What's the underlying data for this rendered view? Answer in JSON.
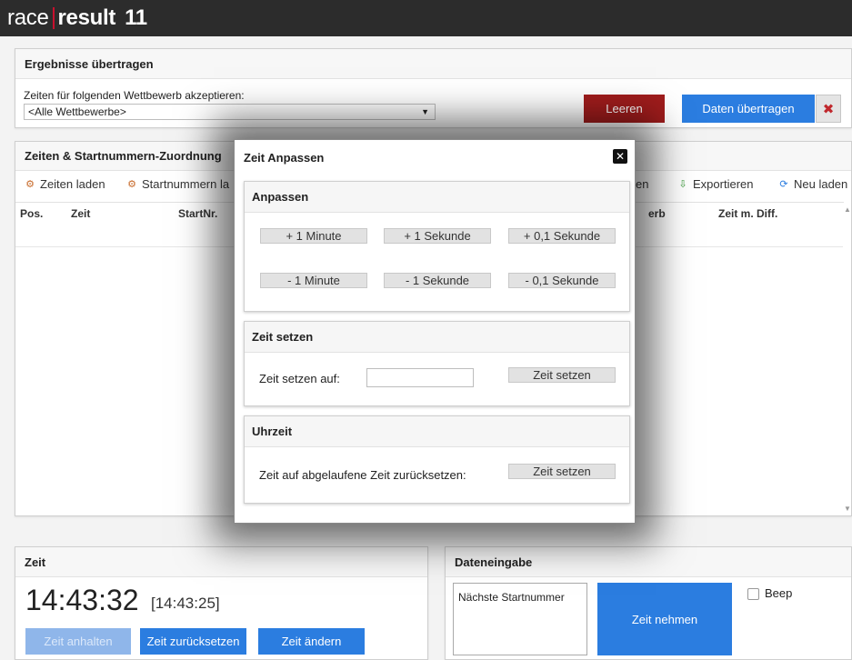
{
  "app": {
    "logo_race": "race",
    "logo_result": "result",
    "logo_version": "11"
  },
  "transfer": {
    "title": "Ergebnisse übertragen",
    "accept_label": "Zeiten für folgenden Wettbewerb akzeptieren:",
    "contest_select_value": "<Alle Wettbewerbe>",
    "clear_button": "Leeren",
    "transfer_button": "Daten übertragen"
  },
  "assignment": {
    "title": "Zeiten & Startnummern-Zuordnung",
    "toolbar": {
      "load_times": "Zeiten laden",
      "load_bibs": "Startnummern la",
      "partial_en": "en",
      "export": "Exportieren",
      "reload": "Neu laden"
    },
    "columns": {
      "pos": "Pos.",
      "time": "Zeit",
      "bib": "StartNr.",
      "contest_partial": "erb",
      "time_diff": "Zeit m. Diff."
    }
  },
  "clock": {
    "title": "Zeit",
    "time": "14:43:32",
    "secondary_time": "[14:43:25]",
    "stop_button": "Zeit anhalten",
    "reset_button": "Zeit zurücksetzen",
    "change_button": "Zeit ändern"
  },
  "data_entry": {
    "title": "Dateneingabe",
    "next_bib_label": "Nächste Startnummer",
    "take_time_button": "Zeit nehmen",
    "beep_label": "Beep"
  },
  "dialog": {
    "title": "Zeit Anpassen",
    "adjust": {
      "title": "Anpassen",
      "plus_minute": "+ 1 Minute",
      "plus_second": "+ 1 Sekunde",
      "plus_tenth": "+ 0,1 Sekunde",
      "minus_minute": "- 1 Minute",
      "minus_second": "- 1 Sekunde",
      "minus_tenth": "- 0,1 Sekunde"
    },
    "set_time": {
      "title": "Zeit setzen",
      "label": "Zeit setzen auf:",
      "value": "",
      "button": "Zeit setzen"
    },
    "clock": {
      "title": "Uhrzeit",
      "label": "Zeit auf abgelaufene Zeit zurücksetzen:",
      "button": "Zeit setzen"
    }
  },
  "colors": {
    "topbar": "#2c2c2c",
    "accent_red": "#a01c1c",
    "accent_blue": "#2b7de0"
  }
}
